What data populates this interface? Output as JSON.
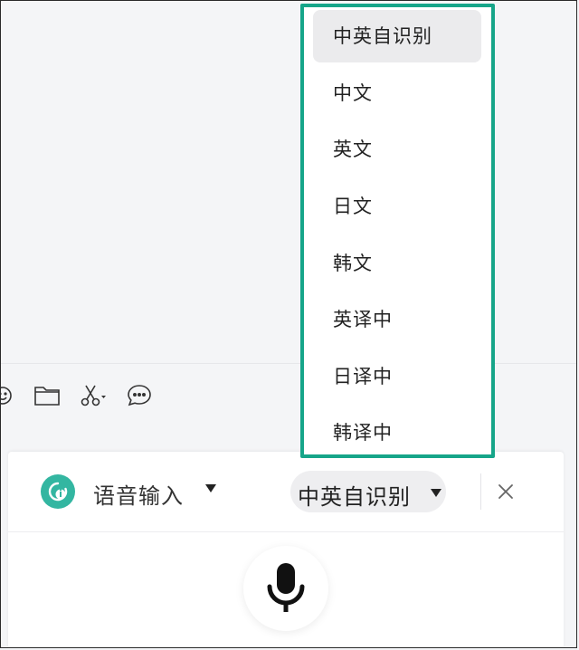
{
  "toolbar": {
    "icons": [
      "emoji-icon",
      "folder-icon",
      "scissors-icon",
      "chat-bubble-icon"
    ]
  },
  "voice_input": {
    "title": "语音输入",
    "language_selected": "中英自识别",
    "logo_icon": "voice-logo-icon",
    "close_icon": "close-icon",
    "mic_icon": "microphone-icon",
    "accent_color": "#33b6a1"
  },
  "language_dropdown": {
    "border_color": "#16a589",
    "options": [
      {
        "label": "中英自识别",
        "selected": true
      },
      {
        "label": "中文",
        "selected": false
      },
      {
        "label": "英文",
        "selected": false
      },
      {
        "label": "日文",
        "selected": false
      },
      {
        "label": "韩文",
        "selected": false
      },
      {
        "label": "英译中",
        "selected": false
      },
      {
        "label": "日译中",
        "selected": false
      },
      {
        "label": "韩译中",
        "selected": false
      }
    ]
  }
}
